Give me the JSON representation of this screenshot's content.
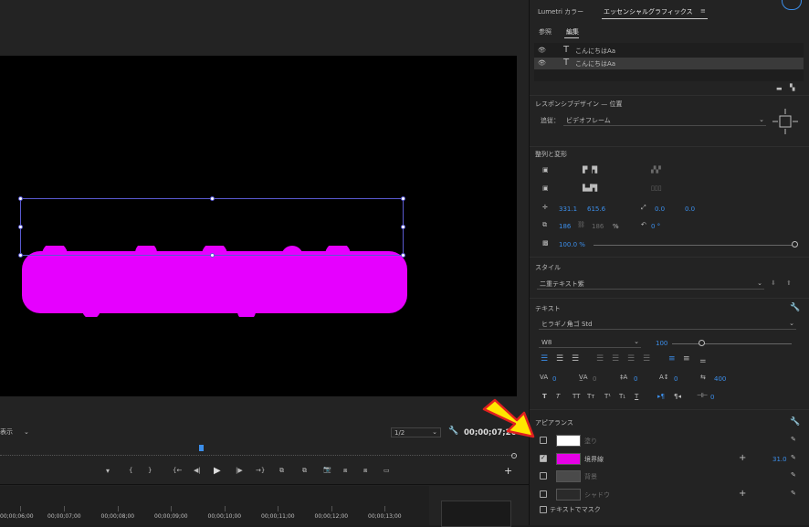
{
  "program_monitor": {
    "fit_label": "表示",
    "resolution": "1/2",
    "timecode": "00;00;07;26",
    "canvas_text": "こんにちはAa",
    "text_fill_color": "#ff00ff"
  },
  "timeline": {
    "ruler_labels": [
      "00;00;06;00",
      "00;00;07;00",
      "00;00;08;00",
      "00;00;09;00",
      "00;00;10;00",
      "00;00;11;00",
      "00;00;12;00",
      "00;00;13;00"
    ]
  },
  "panel": {
    "tabs": [
      {
        "label": "Lumetri カラー",
        "active": false
      },
      {
        "label": "エッセンシャルグラフィックス",
        "active": true
      }
    ],
    "subtabs": [
      {
        "label": "参照",
        "active": false
      },
      {
        "label": "編集",
        "active": true
      }
    ],
    "layers": [
      {
        "name": "こんにちはAa",
        "selected": false
      },
      {
        "name": "こんにちはAa",
        "selected": true
      }
    ],
    "responsive": {
      "header": "レスポンシブデザイン — 位置",
      "pin_label": "追従：",
      "pin_value": "ビデオフレーム"
    },
    "align": {
      "header": "整列と変形",
      "position_x": "331.1",
      "position_y": "615.6",
      "anchor_x": "0.0",
      "anchor_y": "0.0",
      "scale_w": "186",
      "scale_h": "186",
      "scale_unit": "%",
      "rotation": "0 °",
      "opacity": "100.0 %"
    },
    "style": {
      "header": "スタイル",
      "value": "二重テキスト紫"
    },
    "text": {
      "header": "テキスト",
      "font": "ヒラギノ角ゴ Std",
      "weight": "W8",
      "size": "100",
      "tracking": "0",
      "kerning": "0",
      "leading": "0",
      "baseline": "0",
      "tsume": "400",
      "tab": "0"
    },
    "appearance": {
      "header": "アピアランス",
      "rows": [
        {
          "label": "塗り",
          "checked": false,
          "color": "#ffffff",
          "value": ""
        },
        {
          "label": "境界線",
          "checked": true,
          "color": "#e600e6",
          "value": "31.0"
        },
        {
          "label": "背景",
          "checked": false,
          "color": "#4a4a4a",
          "value": ""
        },
        {
          "label": "シャドウ",
          "checked": false,
          "color": "#2a2a2a",
          "value": ""
        }
      ],
      "mask_label": "テキストでマスク"
    }
  }
}
